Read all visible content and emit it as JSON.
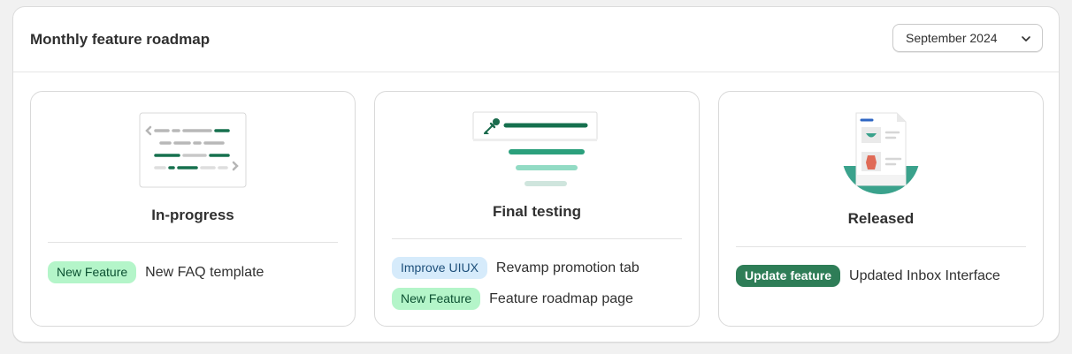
{
  "header": {
    "title": "Monthly feature roadmap",
    "month_selector": "September 2024"
  },
  "columns": [
    {
      "stage": "In-progress",
      "illustration": "code-window-icon",
      "items": [
        {
          "badge": "New Feature",
          "badge_type": "new",
          "text": "New FAQ template"
        }
      ]
    },
    {
      "stage": "Final testing",
      "illustration": "color-picker-funnel-icon",
      "items": [
        {
          "badge": "Improve UIUX",
          "badge_type": "improve",
          "text": "Revamp promotion tab"
        },
        {
          "badge": "New Feature",
          "badge_type": "new",
          "text": "Feature roadmap page"
        }
      ]
    },
    {
      "stage": "Released",
      "illustration": "document-release-icon",
      "items": [
        {
          "badge": "Update feature",
          "badge_type": "update",
          "text": "Updated Inbox Interface"
        }
      ]
    }
  ],
  "colors": {
    "accent_green": "#1a7f5a",
    "new_badge_bg": "#b4f5c9",
    "improve_badge_bg": "#d6ebfb",
    "update_badge_bg": "#2e7d57"
  }
}
